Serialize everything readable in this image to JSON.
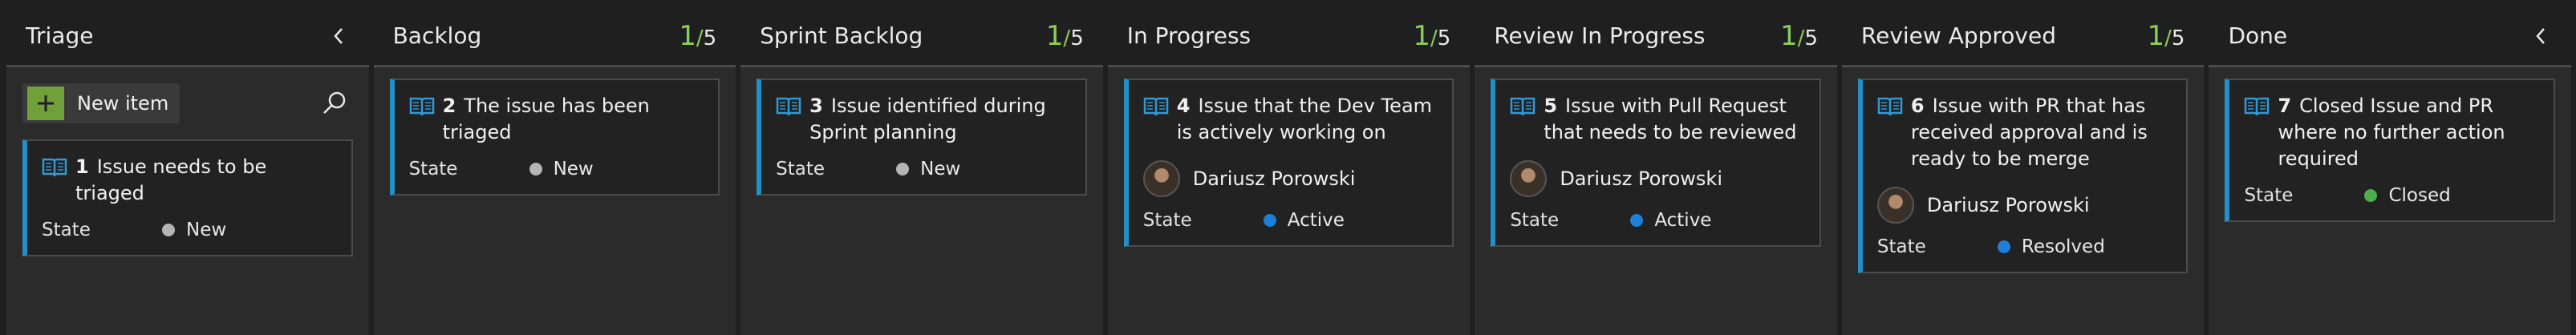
{
  "colors": {
    "accent_green": "#8ccd5a",
    "card_border_blue": "#2290c8",
    "state_new": "#b4b4b4",
    "state_active": "#1f7fd6",
    "state_resolved": "#1f7fd6",
    "state_closed": "#4cae4f"
  },
  "columns": [
    {
      "title": "Triage",
      "collapse_icon": "chevron-left-icon",
      "new_item_label": "New item",
      "cards": [
        {
          "id": "1",
          "title": "Issue needs to be triaged",
          "state_label": "State",
          "state": "New",
          "state_color": "#b4b4b4"
        }
      ]
    },
    {
      "title": "Backlog",
      "wip_count": "1",
      "wip_sep": "/",
      "wip_max": "5",
      "cards": [
        {
          "id": "2",
          "title": "The issue has been triaged",
          "state_label": "State",
          "state": "New",
          "state_color": "#b4b4b4"
        }
      ]
    },
    {
      "title": "Sprint Backlog",
      "wip_count": "1",
      "wip_sep": "/",
      "wip_max": "5",
      "cards": [
        {
          "id": "3",
          "title": "Issue identified during Sprint planning",
          "state_label": "State",
          "state": "New",
          "state_color": "#b4b4b4"
        }
      ]
    },
    {
      "title": "In Progress",
      "wip_count": "1",
      "wip_sep": "/",
      "wip_max": "5",
      "cards": [
        {
          "id": "4",
          "title": "Issue that the Dev Team is actively working on",
          "assignee": "Dariusz Porowski",
          "state_label": "State",
          "state": "Active",
          "state_color": "#1f7fd6"
        }
      ]
    },
    {
      "title": "Review In Progress",
      "wip_count": "1",
      "wip_sep": "/",
      "wip_max": "5",
      "cards": [
        {
          "id": "5",
          "title": "Issue with Pull Request that needs to be reviewed",
          "assignee": "Dariusz Porowski",
          "state_label": "State",
          "state": "Active",
          "state_color": "#1f7fd6"
        }
      ]
    },
    {
      "title": "Review Approved",
      "wip_count": "1",
      "wip_sep": "/",
      "wip_max": "5",
      "cards": [
        {
          "id": "6",
          "title": "Issue with PR that has received approval and is ready to be merge",
          "assignee": "Dariusz Porowski",
          "state_label": "State",
          "state": "Resolved",
          "state_color": "#1f7fd6"
        }
      ]
    },
    {
      "title": "Done",
      "collapse_icon": "chevron-left-icon",
      "cards": [
        {
          "id": "7",
          "title": "Closed Issue and PR where no further action required",
          "state_label": "State",
          "state": "Closed",
          "state_color": "#4cae4f"
        }
      ]
    }
  ]
}
